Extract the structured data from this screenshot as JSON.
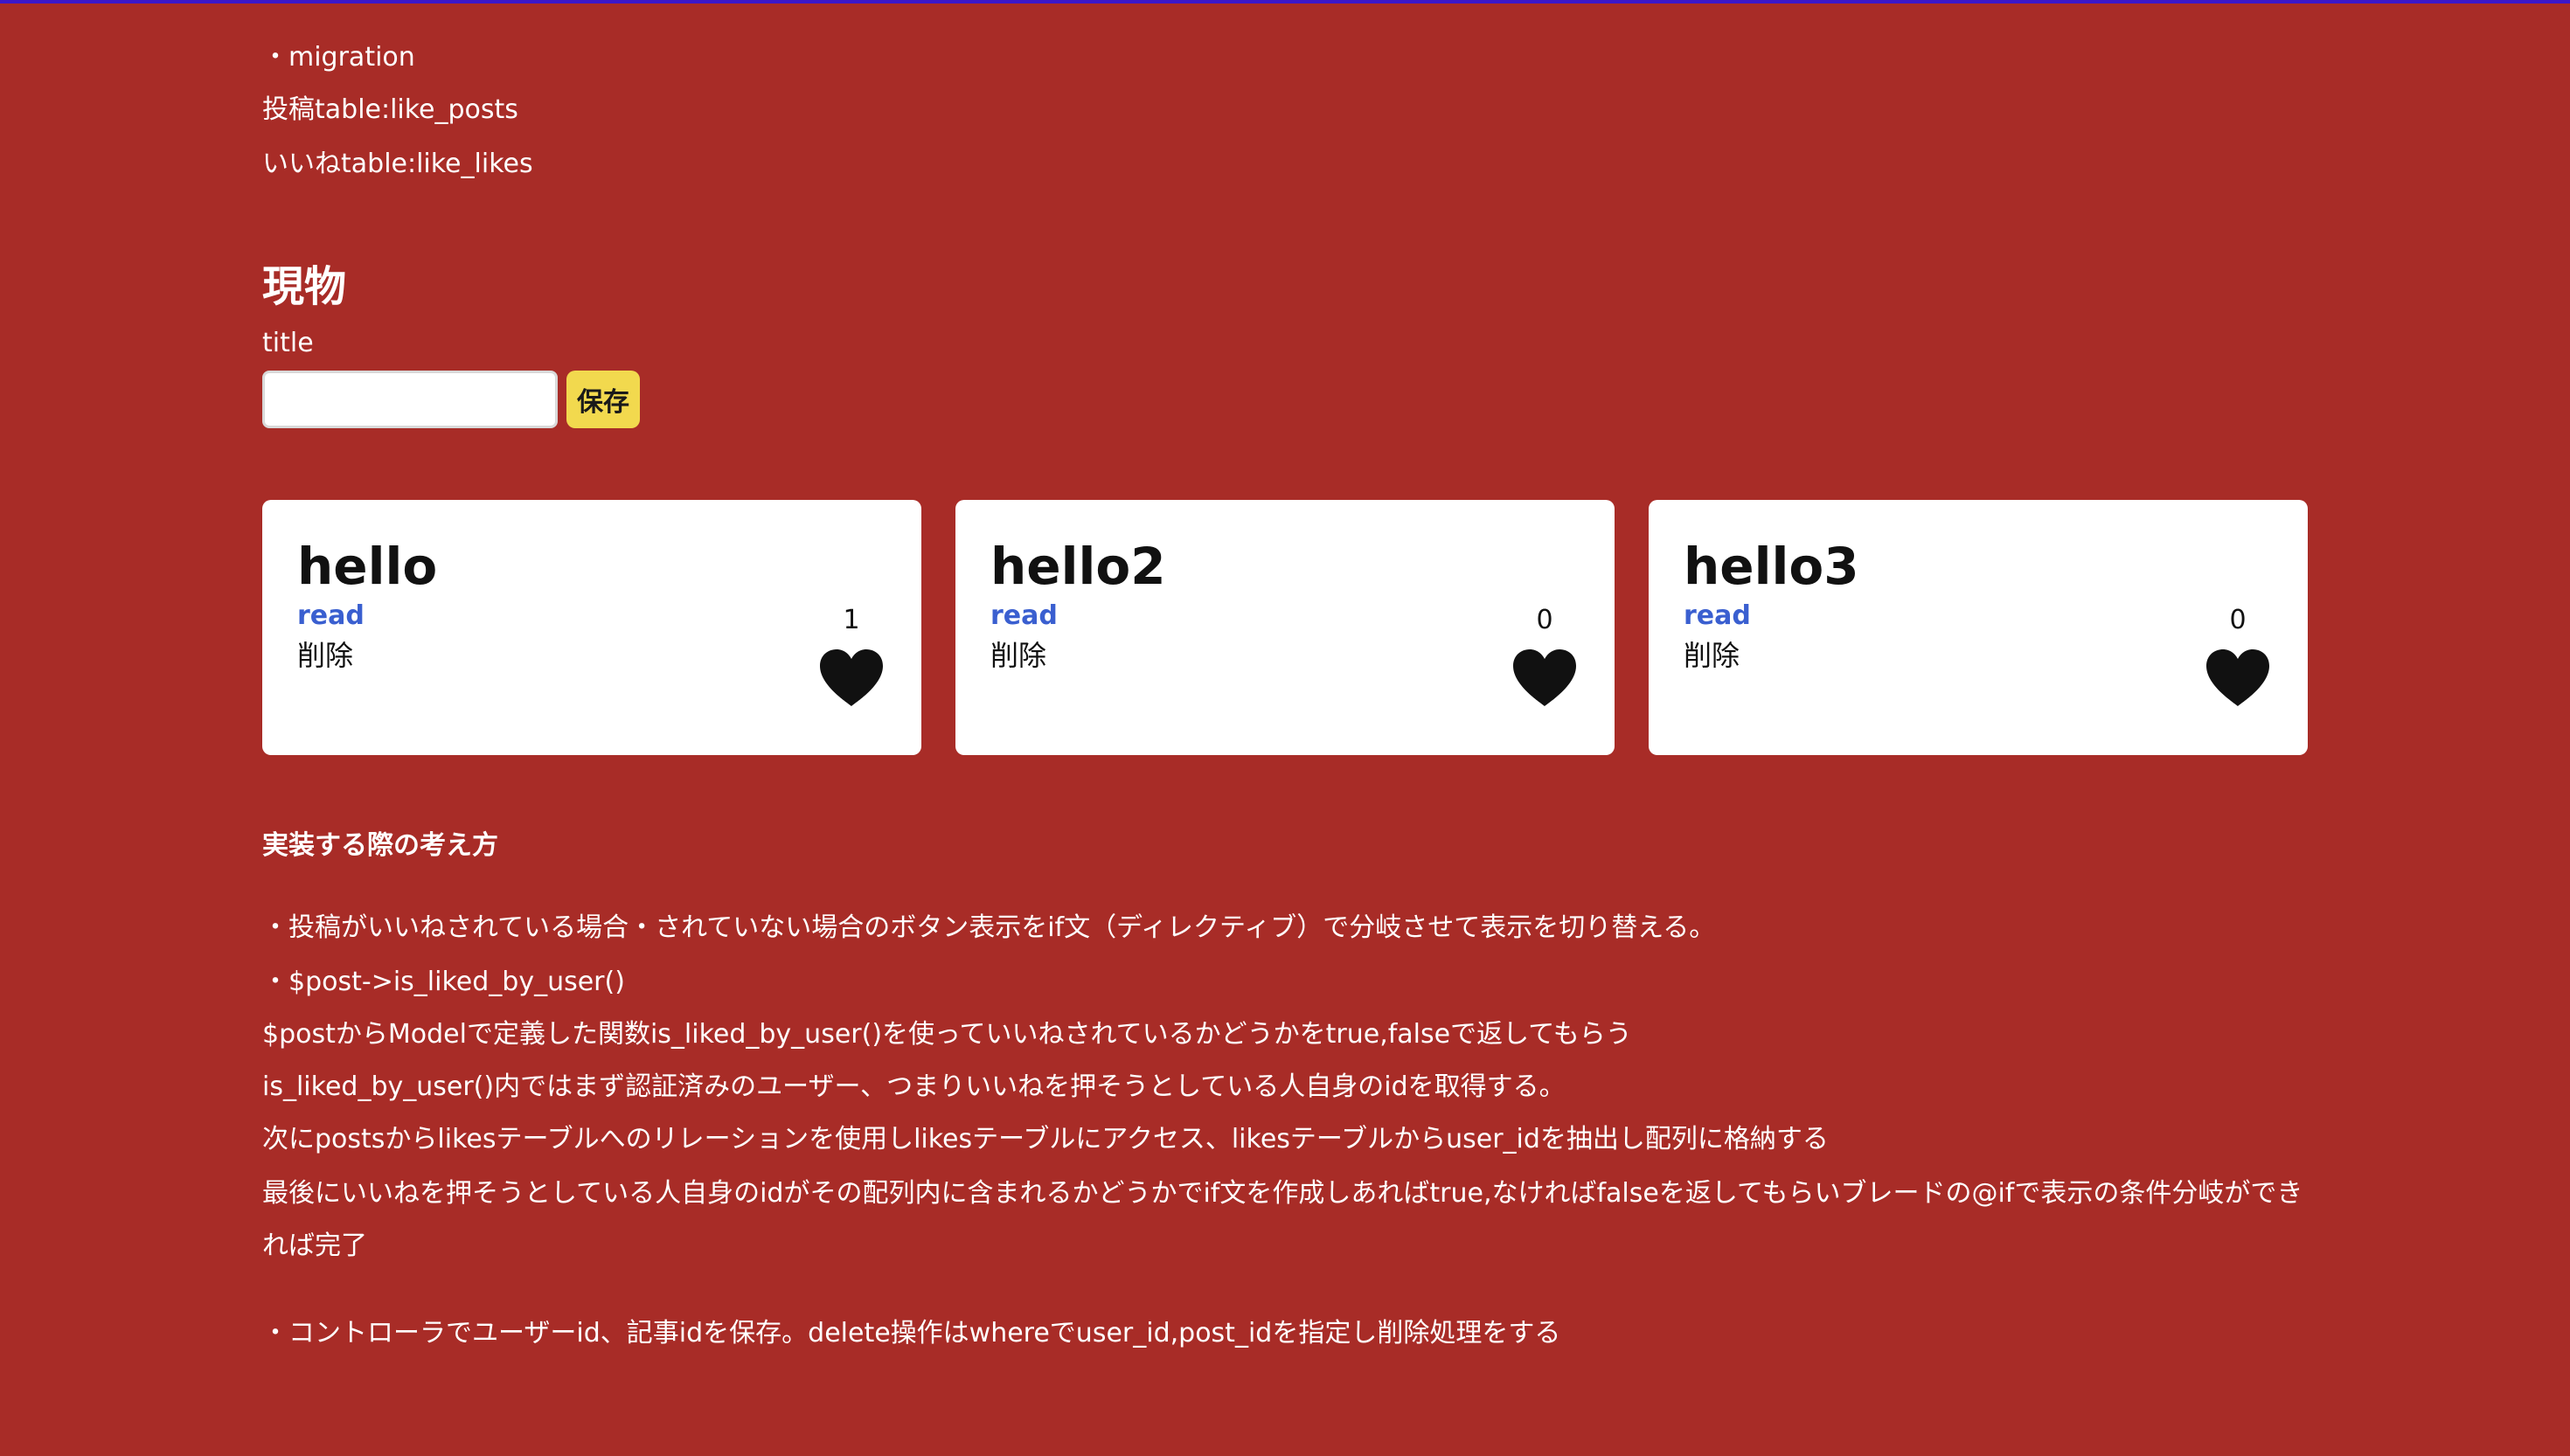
{
  "migration": {
    "label": "・migration",
    "posts_table": "投稿table:like_posts",
    "likes_table": "いいねtable:like_likes"
  },
  "form": {
    "heading": "現物",
    "field_label": "title",
    "input_value": "",
    "save_label": "保存"
  },
  "posts": [
    {
      "title": "hello",
      "read_label": "read",
      "delete_label": "削除",
      "like_count": "1"
    },
    {
      "title": "hello2",
      "read_label": "read",
      "delete_label": "削除",
      "like_count": "0"
    },
    {
      "title": "hello3",
      "read_label": "read",
      "delete_label": "削除",
      "like_count": "0"
    }
  ],
  "notes": {
    "title": "実装する際の考え方",
    "lines": [
      "・投稿がいいねされている場合・されていない場合のボタン表示をif文（ディレクティブ）で分岐させて表示を切り替える。",
      "・$post->is_liked_by_user()",
      "$postからModelで定義した関数is_liked_by_user()を使っていいねされているかどうかをtrue,falseで返してもらう",
      "is_liked_by_user()内ではまず認証済みのユーザー、つまりいいねを押そうとしている人自身のidを取得する。",
      "次にpostsからlikesテーブルへのリレーションを使用しlikesテーブルにアクセス、likesテーブルからuser_idを抽出し配列に格納する",
      "最後にいいねを押そうとしている人自身のidがその配列内に含まれるかどうかでif文を作成しあればtrue,なければfalseを返してもらいブレードの@ifで表示の条件分岐ができれば完了",
      "・コントローラでユーザーid、記事idを保存。delete操作はwhereでuser_id,post_idを指定し削除処理をする"
    ]
  },
  "colors": {
    "background": "#a82c27",
    "button": "#f2d94e",
    "link": "#3a5fd0",
    "heart": "#111111"
  },
  "icons": {
    "like": "black-heart-icon"
  }
}
